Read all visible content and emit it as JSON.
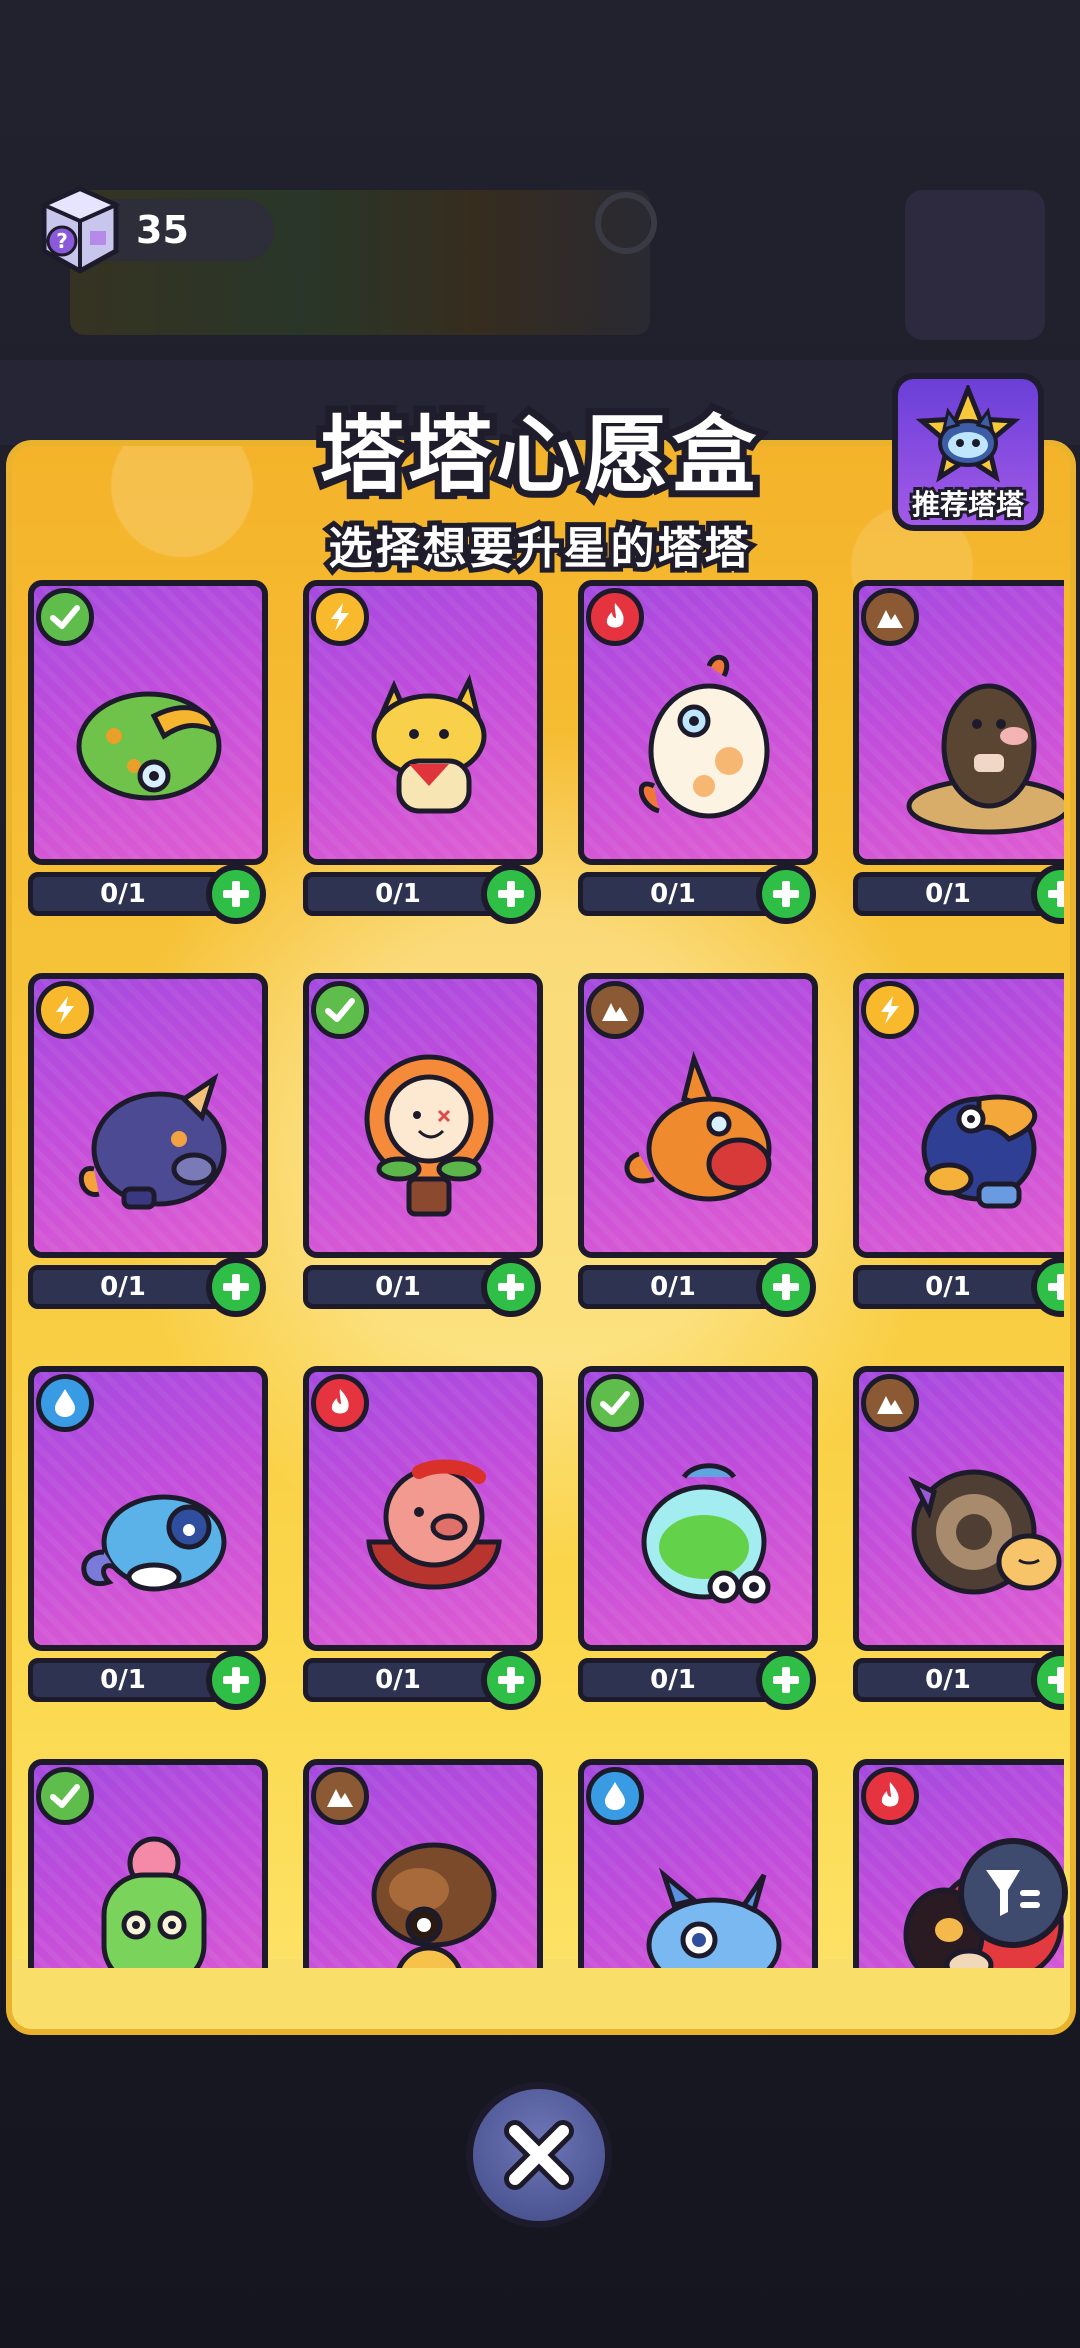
{
  "currency": {
    "amount": "35",
    "icon": "mystery-box-icon"
  },
  "header": {
    "title": "塔塔心愿盒",
    "subtitle": "选择想要升星的塔塔",
    "recommend_label": "推荐塔塔"
  },
  "colors": {
    "grass": "#5fbe4b",
    "electric": "#f8b92c",
    "fire": "#e5333f",
    "earth": "#8b5a34",
    "water": "#3a9be5",
    "panel": "#f7c63b",
    "card": "#b84be0",
    "add": "#2fbf46"
  },
  "cards": [
    {
      "element": "grass",
      "creature": "green-beetle",
      "count": "0/1"
    },
    {
      "element": "electric",
      "creature": "yellow-fox",
      "count": "0/1"
    },
    {
      "element": "fire",
      "creature": "white-chicken",
      "count": "0/1"
    },
    {
      "element": "earth",
      "creature": "brown-mole",
      "count": "0/1"
    },
    {
      "element": "electric",
      "creature": "blue-boar",
      "count": "0/1"
    },
    {
      "element": "grass",
      "creature": "sunflower",
      "count": "0/1"
    },
    {
      "element": "earth",
      "creature": "kangaroo",
      "count": "0/1"
    },
    {
      "element": "electric",
      "creature": "toucan",
      "count": "0/1"
    },
    {
      "element": "water",
      "creature": "chameleon",
      "count": "0/1"
    },
    {
      "element": "fire",
      "creature": "pig-bowl",
      "count": "0/1"
    },
    {
      "element": "grass",
      "creature": "potion-frog",
      "count": "0/1"
    },
    {
      "element": "earth",
      "creature": "hermit-snail",
      "count": "0/1"
    },
    {
      "element": "grass",
      "creature": "cactus",
      "count": ""
    },
    {
      "element": "earth",
      "creature": "shell-snail",
      "count": ""
    },
    {
      "element": "water",
      "creature": "blue-dragon",
      "count": ""
    },
    {
      "element": "fire",
      "creature": "ladybug",
      "count": ""
    }
  ]
}
